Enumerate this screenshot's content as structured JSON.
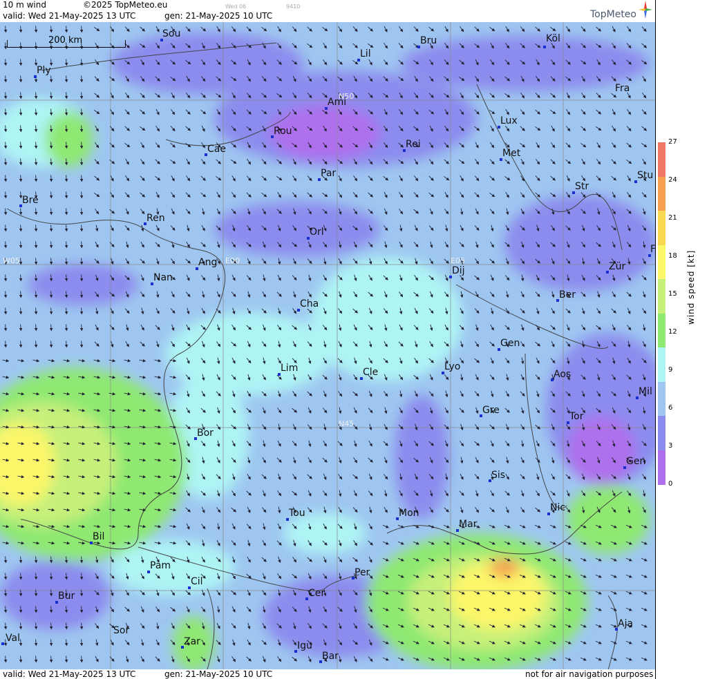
{
  "header": {
    "product": "10 m wind",
    "copyright": "©2025 TopMeteo.eu",
    "tiny1": "Wed 06",
    "tiny2": "9410",
    "valid": "valid:  Wed  21-May-2025  13 UTC",
    "gen": "gen: 21-May-2025 10 UTC",
    "logo": "TopMeteo"
  },
  "footer": {
    "valid": "valid:  Wed  21-May-2025  13 UTC",
    "gen": "gen: 21-May-2025 10 UTC",
    "disclaimer": "not for air navigation purposes"
  },
  "scale": {
    "label": "200 km"
  },
  "colorbar": {
    "title": "wind speed [kt]",
    "ticks": [
      "27",
      "24",
      "21",
      "18",
      "15",
      "12",
      "9",
      "6",
      "3",
      "0"
    ],
    "colors": [
      "#ee7766",
      "#f4a050",
      "#f8d850",
      "#fbf66a",
      "#c6f07a",
      "#8ee872",
      "#aef4f4",
      "#9ec6f0",
      "#8c8cee",
      "#ae70ec"
    ]
  },
  "grid_labels": [
    "N50",
    "N45",
    "E00",
    "E05",
    "W05"
  ],
  "cities": [
    {
      "name": "Sou"
    },
    {
      "name": "Lil"
    },
    {
      "name": "Bru"
    },
    {
      "name": "Köl"
    },
    {
      "name": "Ply"
    },
    {
      "name": "Ami"
    },
    {
      "name": "Fra"
    },
    {
      "name": "Rou"
    },
    {
      "name": "Lux"
    },
    {
      "name": "Cae"
    },
    {
      "name": "Rei"
    },
    {
      "name": "Met"
    },
    {
      "name": "Par"
    },
    {
      "name": "Stu"
    },
    {
      "name": "Bre"
    },
    {
      "name": "Str"
    },
    {
      "name": "Ren"
    },
    {
      "name": "Orl"
    },
    {
      "name": "Ang"
    },
    {
      "name": "Dij"
    },
    {
      "name": "Zür"
    },
    {
      "name": "Nan"
    },
    {
      "name": "Cha"
    },
    {
      "name": "Ber"
    },
    {
      "name": "Gen"
    },
    {
      "name": "Lim"
    },
    {
      "name": "Cle"
    },
    {
      "name": "Lyo"
    },
    {
      "name": "Aos"
    },
    {
      "name": "Mil"
    },
    {
      "name": "Gre"
    },
    {
      "name": "Tor"
    },
    {
      "name": "Bor"
    },
    {
      "name": "Gen"
    },
    {
      "name": "Sis"
    },
    {
      "name": "Nic"
    },
    {
      "name": "Tou"
    },
    {
      "name": "Mon"
    },
    {
      "name": "Mar"
    },
    {
      "name": "Bil"
    },
    {
      "name": "Pam"
    },
    {
      "name": "Per"
    },
    {
      "name": "Cil"
    },
    {
      "name": "Bur"
    },
    {
      "name": "Cer"
    },
    {
      "name": "Aja"
    },
    {
      "name": "Sor"
    },
    {
      "name": "Val"
    },
    {
      "name": "Zar"
    },
    {
      "name": "Igu"
    },
    {
      "name": "Bar"
    },
    {
      "name": "F"
    }
  ]
}
